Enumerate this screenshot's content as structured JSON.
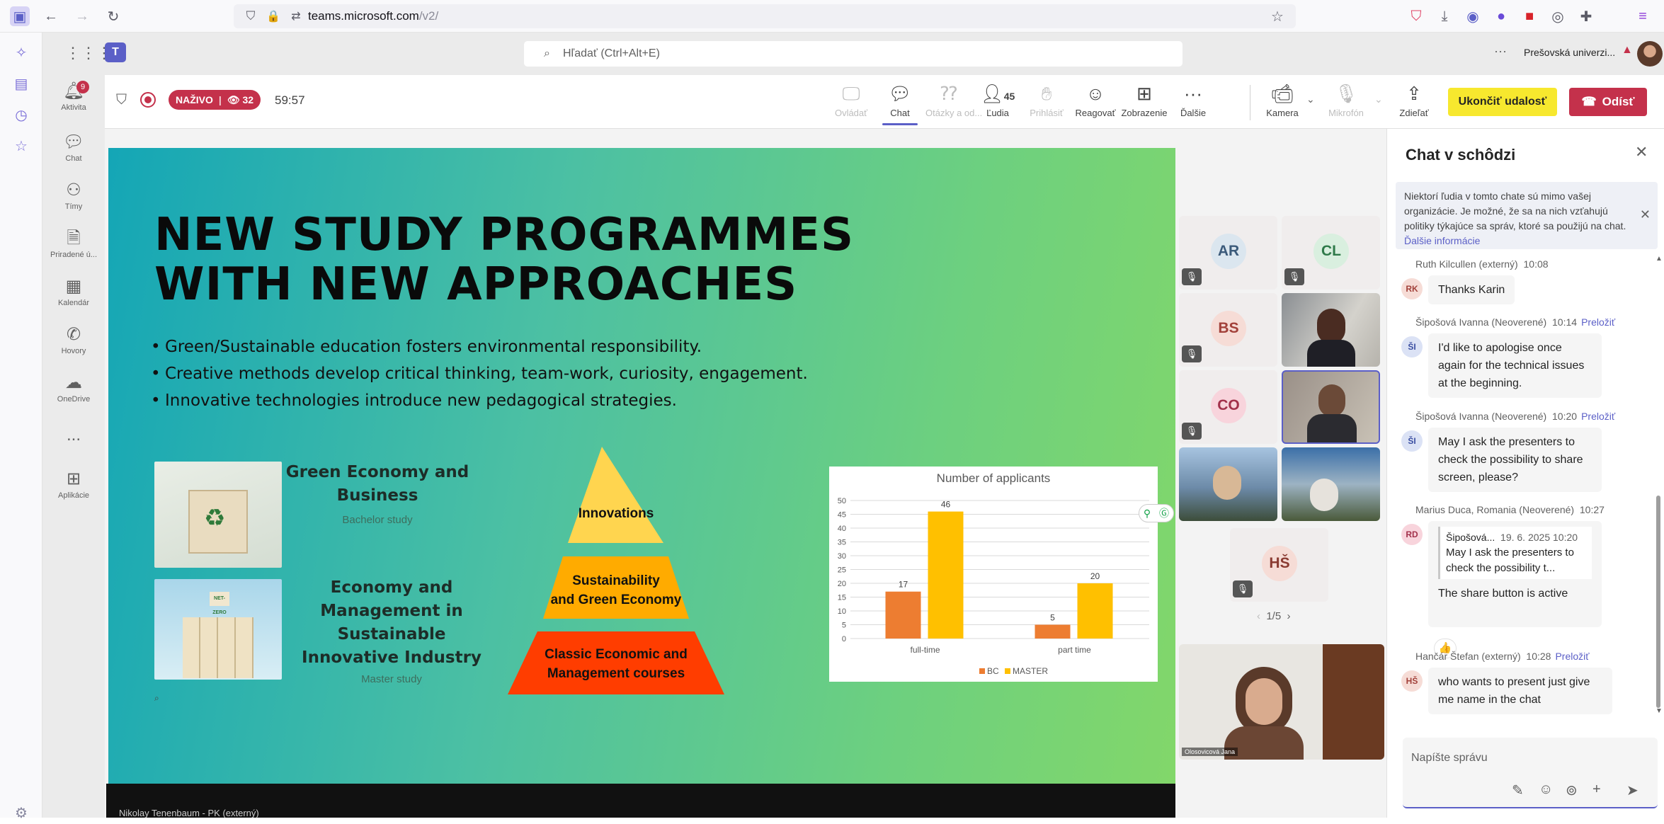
{
  "browser": {
    "url_domain": "teams.microsoft.com",
    "url_path": "/v2/"
  },
  "header": {
    "search_placeholder": "Hľadať (Ctrl+Alt+E)",
    "org_name": "Prešovská univerzi..."
  },
  "rail": {
    "items": [
      {
        "label": "Aktivita",
        "badge": "9"
      },
      {
        "label": "Chat"
      },
      {
        "label": "Tímy"
      },
      {
        "label": "Priradené ú..."
      },
      {
        "label": "Kalendár"
      },
      {
        "label": "Hovory"
      },
      {
        "label": "OneDrive"
      },
      {
        "label": "..."
      },
      {
        "label": "Aplikácie"
      }
    ]
  },
  "toolbar": {
    "live_label": "NAŽIVO",
    "viewers": "32",
    "timer": "59:57",
    "buttons": [
      {
        "label": "Ovládať"
      },
      {
        "label": "Chat"
      },
      {
        "label": "Otázky a od..."
      },
      {
        "label": "Ľudia",
        "count": "45"
      },
      {
        "label": "Prihlásiť"
      },
      {
        "label": "Reagovať"
      },
      {
        "label": "Zobrazenie"
      },
      {
        "label": "Ďalšie"
      },
      {
        "label": "Kamera"
      },
      {
        "label": "Mikrofón"
      },
      {
        "label": "Zdieľať"
      }
    ],
    "end_event": "Ukončiť udalosť",
    "leave": "Odísť"
  },
  "slide": {
    "title_line1": "NEW STUDY PROGRAMMES",
    "title_line2": "WITH NEW APPROACHES",
    "bullets": [
      "Green/Sustainable education fosters environmental responsibility.",
      "Creative methods develop critical thinking, team-work, curiosity, engagement.",
      "Innovative technologies introduce new pedagogical strategies."
    ],
    "programme1_title": "Green Economy and Business",
    "programme1_sub": "Bachelor study",
    "programme2_title": "Economy and Management in Sustainable Innovative Industry",
    "programme2_sub": "Master study",
    "pyramid": {
      "top": "Innovations",
      "middle_l1": "Sustainability",
      "middle_l2": "and Green Economy",
      "bottom_l1": "Classic Economic and",
      "bottom_l2": "Management courses"
    },
    "netzero": "NET-ZERO"
  },
  "chart_data": {
    "type": "bar",
    "title": "Number of applicants",
    "categories": [
      "full-time",
      "part time"
    ],
    "series": [
      {
        "name": "BC",
        "values": [
          17,
          5
        ],
        "color": "#ed7d31"
      },
      {
        "name": "MASTER",
        "values": [
          46,
          20
        ],
        "color": "#ffc000"
      }
    ],
    "ylim": [
      0,
      50
    ],
    "yticks": [
      0,
      5,
      10,
      15,
      20,
      25,
      30,
      35,
      40,
      45,
      50
    ],
    "grid": true,
    "legend": "bottom"
  },
  "participants": {
    "tiles": [
      {
        "initials": "AR"
      },
      {
        "initials": "CL"
      },
      {
        "initials": "BS"
      },
      {
        "initials": "CO"
      },
      {
        "initials": "HŠ"
      }
    ],
    "pager": "1/5",
    "self_name": "Olosovicová Jana"
  },
  "chat": {
    "title": "Chat v schôdzi",
    "notice": "Niektorí ľudia v tomto chate sú mimo vašej organizácie. Je možné, že sa na nich vzťahujú politiky týkajúce sa správ, ktoré sa použijú na chat.",
    "notice_link": "Ďalšie informácie",
    "translate": "Preložiť",
    "messages": [
      {
        "author": "Ruth Kilcullen (externý)",
        "time": "10:08",
        "initials": "RK",
        "text": "Thanks Karin"
      },
      {
        "author": "Šipošová Ivanna (Neoverené)",
        "time": "10:14",
        "initials": "ŠI",
        "text": "I'd like to apologise once again for the technical issues at the beginning."
      },
      {
        "author": "Šipošová Ivanna (Neoverené)",
        "time": "10:20",
        "initials": "ŠI",
        "text": "May I ask the presenters to check the possibility to share screen, please?"
      },
      {
        "author": "Marius Duca, Romania (Neoverené)",
        "time": "10:27",
        "initials": "RD",
        "quote_author": "Šipošová...",
        "quote_time": "19. 6. 2025 10:20",
        "quote_text": "May I ask the presenters to check the possibility t...",
        "text": "The share button is active",
        "reaction": "👍"
      },
      {
        "author": "Hančár Štefan (externý)",
        "time": "10:28",
        "initials": "HŠ",
        "text": "who wants to present just give me name in the chat"
      }
    ],
    "compose_placeholder": "Napíšte správu"
  },
  "bottombar_text": "Nikolay Tenenbaum - PK (externý)"
}
